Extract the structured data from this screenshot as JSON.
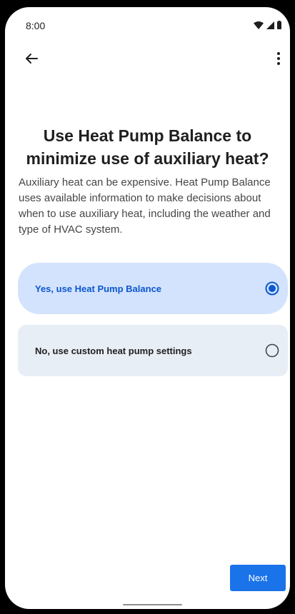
{
  "status_bar": {
    "time": "8:00",
    "icons": [
      "wifi-icon",
      "cell-signal-icon",
      "battery-icon"
    ]
  },
  "top_bar": {
    "back_icon": "arrow-back-icon",
    "more_icon": "more-vert-icon"
  },
  "content": {
    "title": "Use Heat Pump Balance to minimize use of auxiliary heat?",
    "description": "Auxiliary heat can be expensive. Heat Pump Balance uses available information to make decisions about when to use auxiliary heat, including the weather and type of HVAC system."
  },
  "options": [
    {
      "label": "Yes, use Heat Pump Balance",
      "selected": true
    },
    {
      "label": "No, use custom heat pump settings",
      "selected": false
    }
  ],
  "footer": {
    "next_label": "Next"
  },
  "colors": {
    "accent": "#0b57d0",
    "selected_bg": "#d3e3fd",
    "unselected_bg": "#e8eef6",
    "button": "#1a73e8"
  }
}
